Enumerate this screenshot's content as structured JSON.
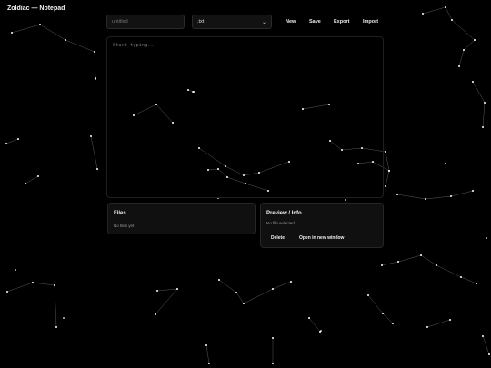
{
  "window": {
    "title": "Zoldiac — Notepad"
  },
  "toolbar": {
    "filename_placeholder": "untitled",
    "extension_value": ".txt",
    "extension_chevron_icon": "chevron-down-icon",
    "new_label": "New",
    "save_label": "Save",
    "export_label": "Export",
    "import_label": "Import"
  },
  "editor": {
    "placeholder": "Start typing..."
  },
  "files_panel": {
    "title": "Files",
    "empty_text": "No files yet"
  },
  "preview_panel": {
    "title": "Preview / Info",
    "info_text": "No file selected",
    "delete_label": "Delete",
    "open_label": "Open in new window"
  },
  "colors": {
    "background": "#000000",
    "star": "#ffffff",
    "line": "#5a5a5a",
    "panel": "#101010"
  }
}
